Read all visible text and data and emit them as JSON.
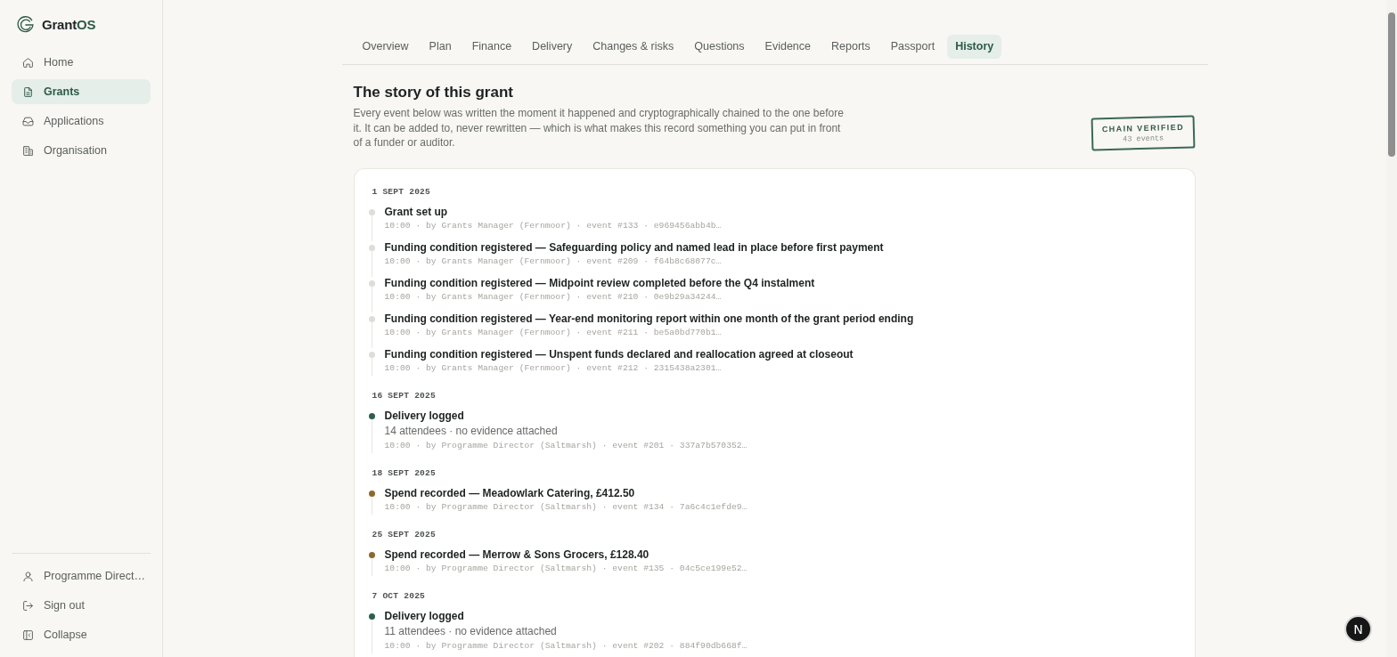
{
  "sidebar": {
    "brand": {
      "name": "Grant",
      "accent": "OS"
    },
    "nav": [
      {
        "label": "Home",
        "selected": false
      },
      {
        "label": "Grants",
        "selected": true
      },
      {
        "label": "Applications",
        "selected": false
      },
      {
        "label": "Organisation",
        "selected": false
      }
    ],
    "footer": [
      {
        "label": "Programme Direct…"
      },
      {
        "label": "Sign out"
      },
      {
        "label": "Collapse"
      }
    ]
  },
  "tabs": [
    {
      "label": "Overview",
      "selected": false
    },
    {
      "label": "Plan",
      "selected": false
    },
    {
      "label": "Finance",
      "selected": false
    },
    {
      "label": "Delivery",
      "selected": false
    },
    {
      "label": "Changes & risks",
      "selected": false
    },
    {
      "label": "Questions",
      "selected": false
    },
    {
      "label": "Evidence",
      "selected": false
    },
    {
      "label": "Reports",
      "selected": false
    },
    {
      "label": "Passport",
      "selected": false
    },
    {
      "label": "History",
      "selected": true
    }
  ],
  "header": {
    "title": "The story of this grant",
    "description": "Every event below was written the moment it happened and cryptographically chained to the one before it. It can be added to, never rewritten — which is what makes this record something you can put in front of a funder or auditor.",
    "stamp": {
      "title": "CHAIN VERIFIED",
      "count": "43 events"
    }
  },
  "timeline": [
    {
      "date": "1 SEPT 2025",
      "events": [
        {
          "title": "Grant set up",
          "meta": "10:00 · by Grants Manager (Fernmoor) · event #133 · e969456abb4b…",
          "color": "#dcdfd8"
        },
        {
          "title": "Funding condition registered — Safeguarding policy and named lead in place before first payment",
          "meta": "10:00 · by Grants Manager (Fernmoor) · event #209 · f64b8c68077c…",
          "color": "#dcdfd8"
        },
        {
          "title": "Funding condition registered — Midpoint review completed before the Q4 instalment",
          "meta": "10:00 · by Grants Manager (Fernmoor) · event #210 · 0e9b29a34244…",
          "color": "#dcdfd8"
        },
        {
          "title": "Funding condition registered — Year-end monitoring report within one month of the grant period ending",
          "meta": "10:00 · by Grants Manager (Fernmoor) · event #211 · be5a0bd770b1…",
          "color": "#dcdfd8"
        },
        {
          "title": "Funding condition registered — Unspent funds declared and reallocation agreed at closeout",
          "meta": "10:00 · by Grants Manager (Fernmoor) · event #212 · 2315438a2301…",
          "color": "#dcdfd8"
        }
      ]
    },
    {
      "date": "16 SEPT 2025",
      "events": [
        {
          "title": "Delivery logged",
          "detail": "14 attendees · no evidence attached",
          "meta": "10:00 · by Programme Director (Saltmarsh) · event #201 · 337a7b570352…",
          "color": "#2e5e4e"
        }
      ]
    },
    {
      "date": "18 SEPT 2025",
      "events": [
        {
          "title": "Spend recorded — Meadowlark Catering, £412.50",
          "meta": "10:00 · by Programme Director (Saltmarsh) · event #134 · 7a6c4c1efde9…",
          "color": "#8b6a2b"
        }
      ]
    },
    {
      "date": "25 SEPT 2025",
      "events": [
        {
          "title": "Spend recorded — Merrow & Sons Grocers, £128.40",
          "meta": "10:00 · by Programme Director (Saltmarsh) · event #135 · 04c5ce199e52…",
          "color": "#8b6a2b"
        }
      ]
    },
    {
      "date": "7 OCT 2025",
      "events": [
        {
          "title": "Delivery logged",
          "detail": "11 attendees · no evidence attached",
          "meta": "10:00 · by Programme Director (Saltmarsh) · event #202 · 884f90db668f…",
          "color": "#2e5e4e"
        }
      ]
    }
  ],
  "dev_badge": {
    "label": "N"
  }
}
